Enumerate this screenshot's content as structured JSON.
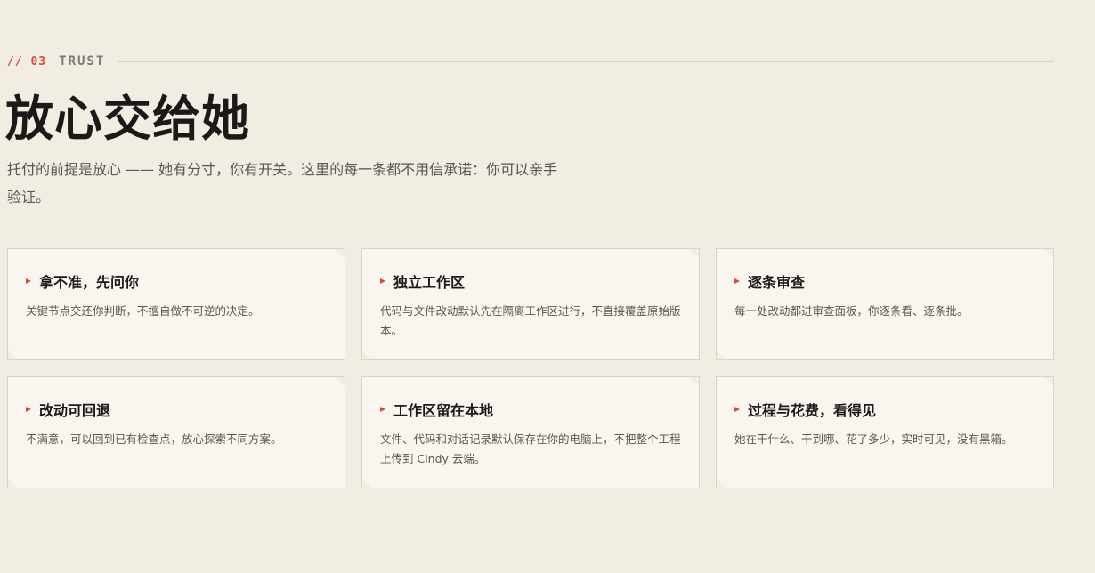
{
  "section": {
    "number": "// 03",
    "tag": "TRUST"
  },
  "title": "放心交给她",
  "subtitle": "托付的前提是放心 —— 她有分寸，你有开关。这里的每一条都不用信承诺：你可以亲手验证。",
  "cards": [
    {
      "title": "拿不准，先问你",
      "desc": "关键节点交还你判断，不擅自做不可逆的决定。",
      "icon": "arrow-right-icon"
    },
    {
      "title": "独立工作区",
      "desc": "代码与文件改动默认先在隔离工作区进行，不直接覆盖原始版本。",
      "icon": "arrow-right-icon"
    },
    {
      "title": "逐条审查",
      "desc": "每一处改动都进审查面板，你逐条看、逐条批。",
      "icon": "arrow-right-icon"
    },
    {
      "title": "改动可回退",
      "desc": "不满意，可以回到已有检查点，放心探索不同方案。",
      "icon": "arrow-right-icon"
    },
    {
      "title": "工作区留在本地",
      "desc": "文件、代码和对话记录默认保存在你的电脑上，不把整个工程上传到 Cindy 云端。",
      "icon": "arrow-right-icon"
    },
    {
      "title": "过程与花费，看得见",
      "desc": "她在干什么、干到哪、花了多少，实时可见，没有黑箱。",
      "icon": "arrow-right-icon"
    }
  ],
  "colors": {
    "background": "#f2ede3",
    "card_background": "#faf6ef",
    "accent": "#e0453a",
    "text": "#1c1a18",
    "muted_text": "#5a5651"
  }
}
